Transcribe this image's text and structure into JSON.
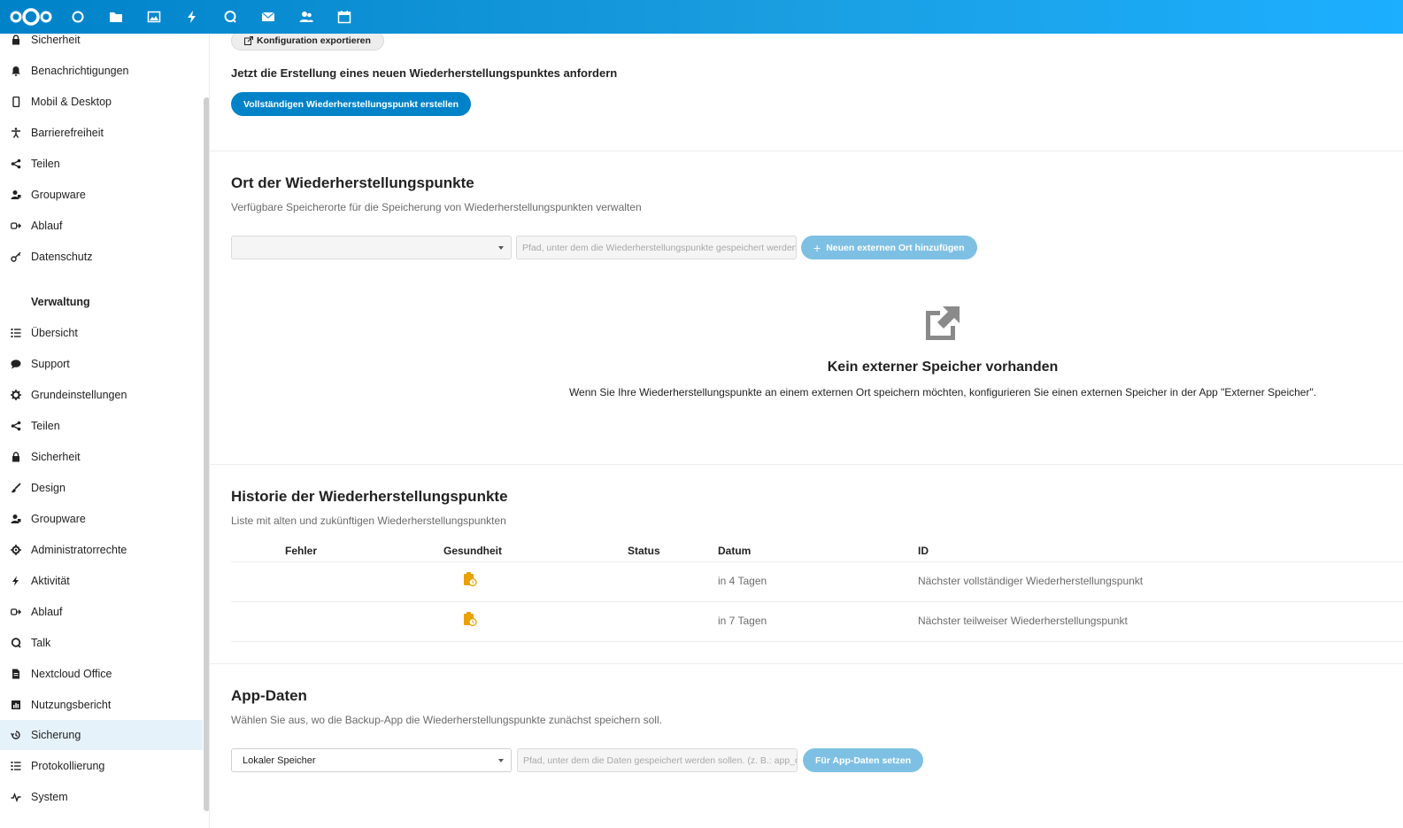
{
  "header": {
    "nav": [
      {
        "name": "dashboard-icon"
      },
      {
        "name": "files-icon"
      },
      {
        "name": "photos-icon"
      },
      {
        "name": "activity-icon"
      },
      {
        "name": "talk-icon"
      },
      {
        "name": "mail-icon"
      },
      {
        "name": "contacts-icon"
      },
      {
        "name": "calendar-icon"
      }
    ]
  },
  "sidebar": {
    "personal_items": [
      {
        "label": "Sicherheit",
        "icon": "lock-icon"
      },
      {
        "label": "Benachrichtigungen",
        "icon": "bell-icon"
      },
      {
        "label": "Mobil & Desktop",
        "icon": "phone-icon"
      },
      {
        "label": "Barrierefreiheit",
        "icon": "accessibility-icon"
      },
      {
        "label": "Teilen",
        "icon": "share-icon"
      },
      {
        "label": "Groupware",
        "icon": "groupware-icon"
      },
      {
        "label": "Ablauf",
        "icon": "flow-icon"
      },
      {
        "label": "Datenschutz",
        "icon": "key-icon"
      }
    ],
    "admin_heading": "Verwaltung",
    "admin_items": [
      {
        "label": "Übersicht",
        "icon": "list-icon"
      },
      {
        "label": "Support",
        "icon": "chat-icon"
      },
      {
        "label": "Grundeinstellungen",
        "icon": "gear-icon"
      },
      {
        "label": "Teilen",
        "icon": "share-icon"
      },
      {
        "label": "Sicherheit",
        "icon": "lock-icon"
      },
      {
        "label": "Design",
        "icon": "brush-icon"
      },
      {
        "label": "Groupware",
        "icon": "groupware-icon"
      },
      {
        "label": "Administratorrechte",
        "icon": "admin-gear-icon"
      },
      {
        "label": "Aktivität",
        "icon": "activity-icon"
      },
      {
        "label": "Ablauf",
        "icon": "flow-icon"
      },
      {
        "label": "Talk",
        "icon": "talk-icon"
      },
      {
        "label": "Nextcloud Office",
        "icon": "document-icon"
      },
      {
        "label": "Nutzungsbericht",
        "icon": "report-icon"
      },
      {
        "label": "Sicherung",
        "icon": "restore-icon",
        "active": true
      },
      {
        "label": "Protokollierung",
        "icon": "list-icon"
      },
      {
        "label": "System",
        "icon": "pulse-icon"
      }
    ]
  },
  "main": {
    "export_button": "Konfiguration exportieren",
    "request_text": "Jetzt die Erstellung eines neuen Wiederherstellungspunktes anfordern",
    "create_button": "Vollständigen Wiederherstellungspunkt erstellen",
    "location": {
      "title": "Ort der Wiederherstellungspunkte",
      "description": "Verfügbare Speicherorte für die Speicherung von Wiederherstellungspunkten verwalten",
      "select_value": "",
      "path_placeholder": "Pfad, unter dem die Wiederherstellungspunkte gespeichert werden",
      "add_button": "Neuen externen Ort hinzufügen",
      "empty_title": "Kein externer Speicher vorhanden",
      "empty_description": "Wenn Sie Ihre Wiederherstellungspunkte an einem externen Ort speichern möchten, konfigurieren Sie einen externen Speicher in der App \"Externer Speicher\"."
    },
    "history": {
      "title": "Historie der Wiederherstellungspunkte",
      "description": "Liste mit alten und zukünftigen Wiederherstellungspunkten",
      "columns": [
        "Fehler",
        "Gesundheit",
        "Status",
        "Datum",
        "ID"
      ],
      "rows": [
        {
          "health_icon": "scheduled-icon",
          "date": "in 4 Tagen",
          "id": "Nächster vollständiger Wiederherstellungspunkt"
        },
        {
          "health_icon": "scheduled-icon",
          "date": "in 7 Tagen",
          "id": "Nächster teilweiser Wiederherstellungspunkt"
        }
      ]
    },
    "appdata": {
      "title": "App-Daten",
      "description": "Wählen Sie aus, wo die Backup-App die Wiederherstellungspunkte zunächst speichern soll.",
      "select_value": "Lokaler Speicher",
      "path_placeholder": "Pfad, unter dem die Daten gespeichert werden sollen. (z. B.: app_data)",
      "set_button": "Für App-Daten setzen"
    }
  },
  "colors": {
    "primary": "#0082c9",
    "header_gradient_end": "#1cafff",
    "active_bg": "#e6f2fa",
    "warning_icon": "#e9a200"
  }
}
